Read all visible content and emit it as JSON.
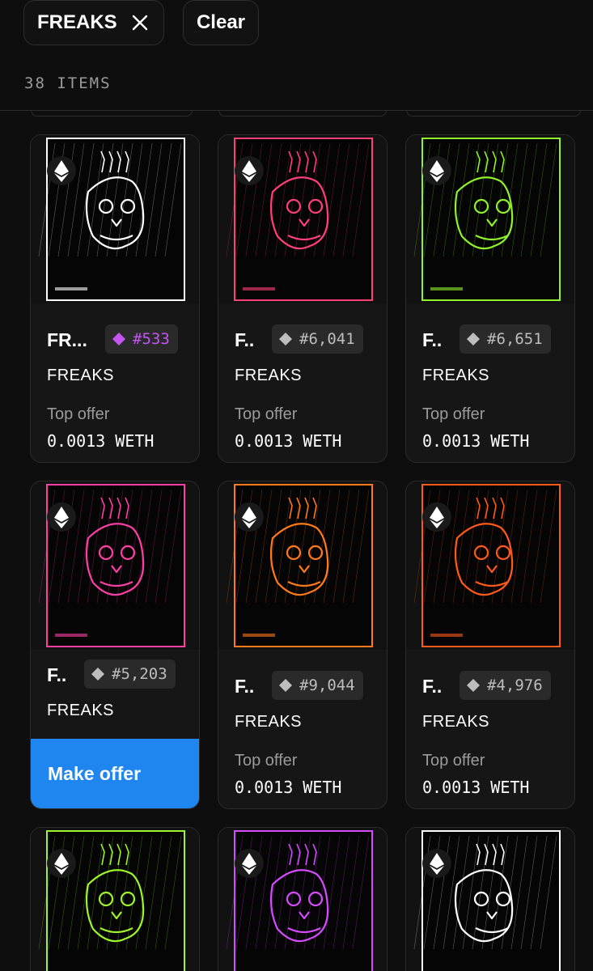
{
  "filters": {
    "active_chip_label": "FREAKS",
    "clear_label": "Clear"
  },
  "results": {
    "count_label": "38 ITEMS"
  },
  "colors": {
    "background": "#0e0e0e",
    "card": "#161616",
    "accent_blue": "#1f86f0",
    "rare_purple": "#c455f2",
    "muted_text": "#9b9b9b"
  },
  "cards": [
    {
      "name": "FR...",
      "token": "#533",
      "rarity": "rare",
      "collection": "FREAKS",
      "offer_label": "Top offer",
      "offer_value": "0.0013 WETH",
      "art_color": "#ffffff",
      "currency_icon": "ethereum-icon"
    },
    {
      "name": "F..",
      "token": "#6,041",
      "rarity": "common",
      "collection": "FREAKS",
      "offer_label": "Top offer",
      "offer_value": "0.0013 WETH",
      "art_color": "#ff3f7a",
      "currency_icon": "ethereum-icon"
    },
    {
      "name": "F..",
      "token": "#6,651",
      "rarity": "common",
      "collection": "FREAKS",
      "offer_label": "Top offer",
      "offer_value": "0.0013 WETH",
      "art_color": "#8ff22b",
      "currency_icon": "ethereum-icon"
    },
    {
      "name": "F..",
      "token": "#5,203",
      "rarity": "common",
      "collection": "FREAKS",
      "action_label": "Make offer",
      "art_color": "#ff3fa4",
      "currency_icon": "ethereum-icon"
    },
    {
      "name": "F..",
      "token": "#9,044",
      "rarity": "common",
      "collection": "FREAKS",
      "offer_label": "Top offer",
      "offer_value": "0.0013 WETH",
      "art_color": "#ff7a1a",
      "currency_icon": "ethereum-icon"
    },
    {
      "name": "F..",
      "token": "#4,976",
      "rarity": "common",
      "collection": "FREAKS",
      "offer_label": "Top offer",
      "offer_value": "0.0013 WETH",
      "art_color": "#ff5a1a",
      "currency_icon": "ethereum-icon"
    },
    {
      "art_color": "#9ff52b",
      "currency_icon": "ethereum-icon"
    },
    {
      "art_color": "#d64bff",
      "currency_icon": "ethereum-icon"
    },
    {
      "art_color": "#ffffff",
      "currency_icon": "ethereum-icon"
    }
  ]
}
